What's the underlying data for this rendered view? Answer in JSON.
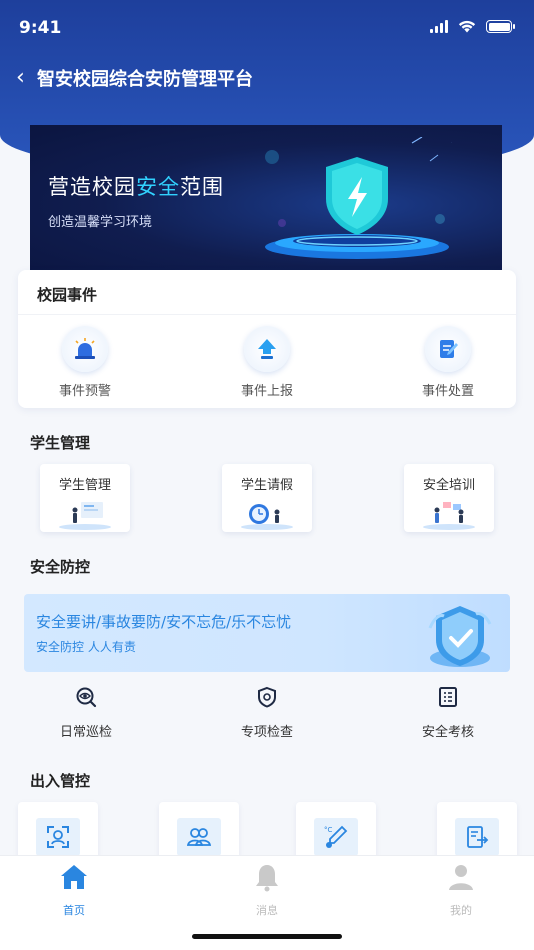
{
  "status_bar": {
    "time": "9:41"
  },
  "nav": {
    "back_icon": "chevron-left-icon",
    "title": "智安校园综合安防管理平台"
  },
  "banner": {
    "title_before": "营造校园",
    "title_highlight": "安全",
    "title_after": "范围",
    "subtitle": "创造温馨学习环境"
  },
  "events": {
    "title": "校园事件",
    "items": [
      {
        "label": "事件预警",
        "icon": "alarm-light-icon"
      },
      {
        "label": "事件上报",
        "icon": "upload-arrow-icon"
      },
      {
        "label": "事件处置",
        "icon": "edit-document-icon"
      }
    ]
  },
  "student": {
    "title": "学生管理",
    "items": [
      {
        "label": "学生管理"
      },
      {
        "label": "学生请假"
      },
      {
        "label": "安全培训"
      }
    ]
  },
  "safety": {
    "title": "安全防控",
    "banner_line1": "安全要讲/事故要防/安不忘危/乐不忘忧",
    "banner_line2": "安全防控  人人有责",
    "items": [
      {
        "label": "日常巡检",
        "icon": "eye-search-icon"
      },
      {
        "label": "专项检查",
        "icon": "shield-check-icon"
      },
      {
        "label": "安全考核",
        "icon": "checklist-icon"
      }
    ]
  },
  "access": {
    "title": "出入管控",
    "items": [
      {
        "icon": "face-scan-icon"
      },
      {
        "icon": "users-icon"
      },
      {
        "icon": "thermometer-icon"
      },
      {
        "icon": "exit-register-icon"
      }
    ]
  },
  "tabbar": {
    "items": [
      {
        "label": "首页",
        "icon": "home-icon",
        "active": true
      },
      {
        "label": "消息",
        "icon": "bell-icon",
        "active": false
      },
      {
        "label": "我的",
        "icon": "user-icon",
        "active": false
      }
    ]
  },
  "colors": {
    "primary": "#2a86e0",
    "header": "#2349a6"
  }
}
